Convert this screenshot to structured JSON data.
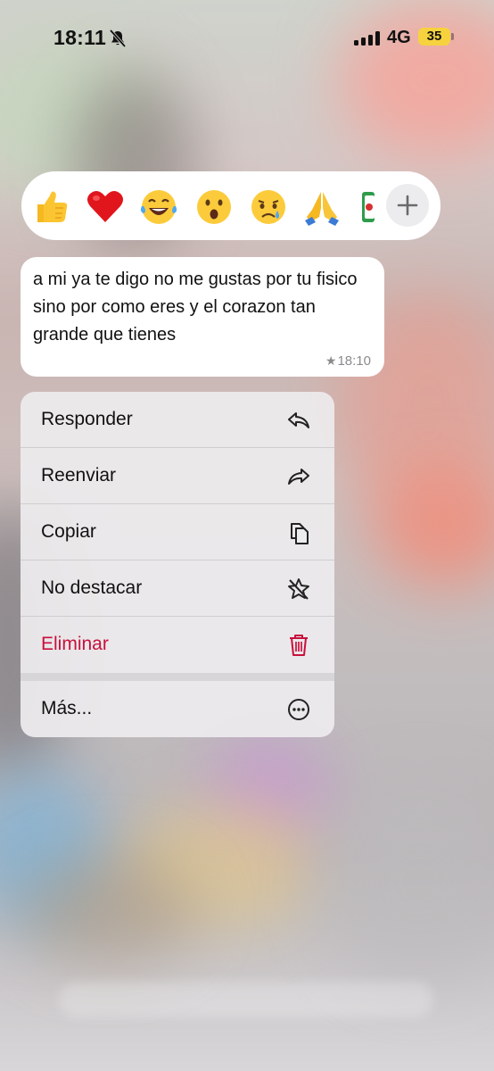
{
  "status_bar": {
    "time": "18:11",
    "network": "4G",
    "battery": "35"
  },
  "reactions": {
    "items": [
      "👍",
      "❤️",
      "😂",
      "😮",
      "😢",
      "🙏"
    ]
  },
  "message": {
    "text": "a mi ya te digo no me gustas por tu fisico sino por como eres y el corazon tan grande que tienes",
    "time": "18:10"
  },
  "context_menu": {
    "items": [
      {
        "label": "Responder",
        "icon": "reply-icon"
      },
      {
        "label": "Reenviar",
        "icon": "forward-icon"
      },
      {
        "label": "Copiar",
        "icon": "copy-icon"
      },
      {
        "label": "No destacar",
        "icon": "unstar-icon"
      },
      {
        "label": "Eliminar",
        "icon": "trash-icon"
      },
      {
        "label": "Más...",
        "icon": "more-icon"
      }
    ],
    "danger_color": "#c8103d"
  }
}
